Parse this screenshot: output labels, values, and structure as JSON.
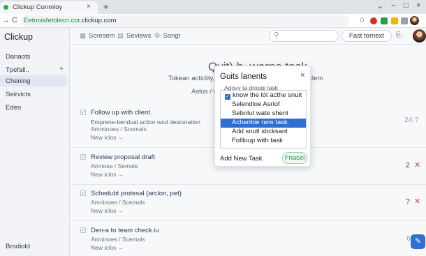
{
  "browser": {
    "tab_title": "Clickup Conmloy",
    "tab_close": "×",
    "new_tab": "+",
    "window_controls": [
      "⌄",
      "−",
      "□",
      "×"
    ],
    "nav": [
      "→",
      "C"
    ],
    "url_prefix": "Eetnoisfetolecn.cor.",
    "url_host": "clickup.com",
    "extensions": [
      {
        "name": "home-icon",
        "glyph": "⌂",
        "color": "#555555"
      },
      {
        "name": "record-icon",
        "color": "#d93025"
      },
      {
        "name": "grid-icon",
        "color": "#2a9d4a"
      },
      {
        "name": "extension-icon",
        "color": "#f4b400"
      },
      {
        "name": "bookmark-icon",
        "color": "#9aa0a6"
      }
    ]
  },
  "sidebar": {
    "brand": "Clickup",
    "items": [
      {
        "label": "Danaots"
      },
      {
        "label": "Tpefall.."
      },
      {
        "label": "Chening"
      },
      {
        "label": "Seirvicts"
      },
      {
        "label": "Edeo"
      }
    ],
    "add": "+",
    "footer": "Brodiold"
  },
  "toolbar": {
    "items": [
      {
        "icon": "▦",
        "label": "Scresem"
      },
      {
        "icon": "▤",
        "label": "Seviews"
      },
      {
        "icon": "⚙",
        "label": "Songt"
      }
    ],
    "search_icon": "⚲",
    "fast_button": "Fast tornext",
    "icon": "⎘"
  },
  "main": {
    "headline": "Qvit) b, worne task",
    "subline": "Tokean acticlity, a ",
    "subline_tail": " scsclem",
    "subline2": "Astus / tre"
  },
  "tasks": [
    {
      "title": "Follow up with client.",
      "line2": "Emprene-bendual action wnd destonation",
      "line3": "Amminoes / Scemals",
      "line4": "New iclos",
      "num": "24.?",
      "x": ""
    },
    {
      "title": "Review proposal draft",
      "line2": "",
      "line3": "Amnoea / Semals",
      "line4": "New iclos",
      "num": "2",
      "x": "✕"
    },
    {
      "title": "Schedubt protesal (arclon, pet)",
      "line2": "",
      "line3": "Amninoes / Scemals",
      "line4": "New iclos",
      "num": "?",
      "x": "✕"
    },
    {
      "title": "Den-a to team check.iu",
      "line2": "",
      "line3": "Amninoes / Scemals",
      "line4": "New iclos",
      "num": "6",
      "x": ""
    }
  ],
  "modal": {
    "title": "Guits lanents",
    "close": "×",
    "hint": "Adovy ta dropgi task",
    "options": [
      {
        "label": "know the lót acthe snuit",
        "checked": true
      },
      {
        "label": "Selendloe Asriof"
      },
      {
        "label": "Sebnlut wate shent"
      },
      {
        "label": "Achenbie new task.",
        "selected": true
      },
      {
        "label": "Add snutl sbcksant"
      },
      {
        "label": "Follloup with task"
      }
    ],
    "add_task": "Add New Task",
    "finalize": "Fnacel"
  },
  "fab_icon": "✎",
  "colors": {
    "accent": "#2f6fd1",
    "danger": "#d0453d",
    "success": "#2e8b57"
  }
}
